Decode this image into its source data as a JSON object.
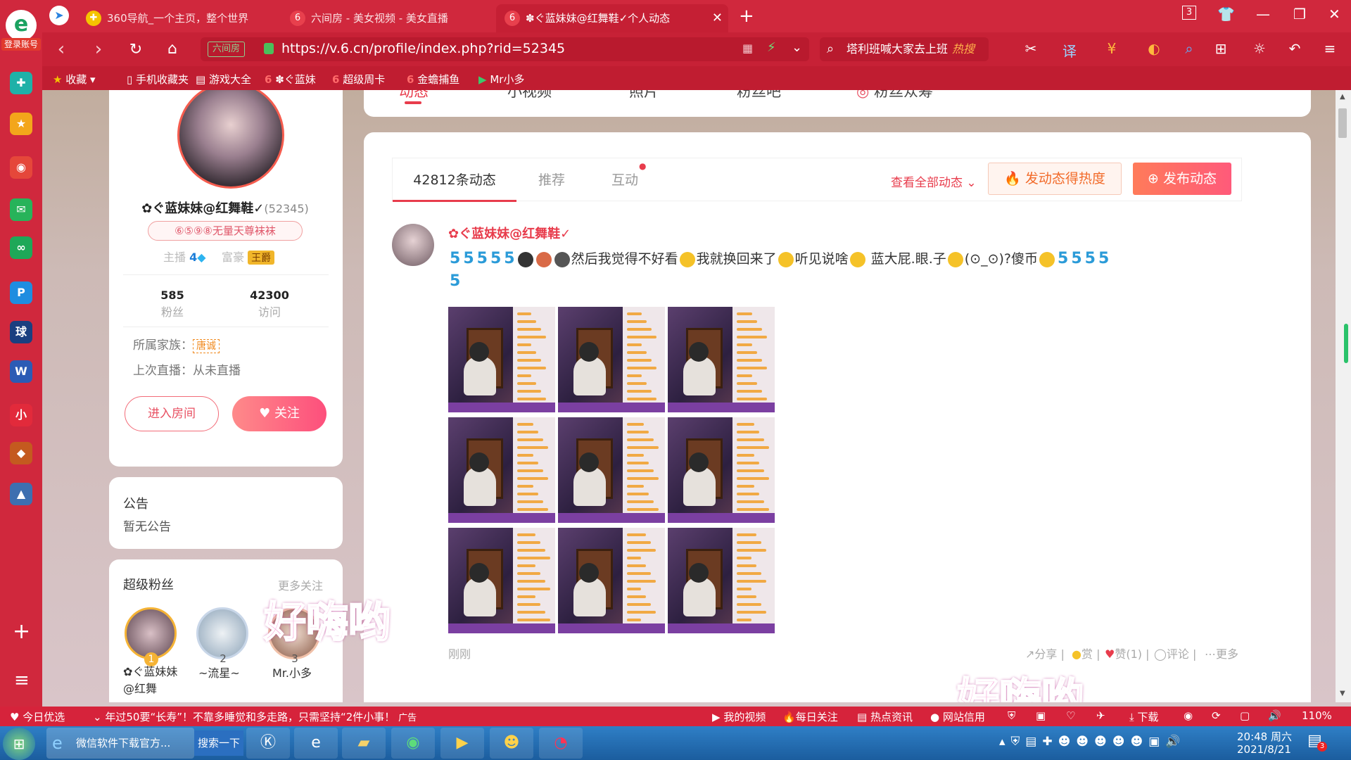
{
  "leftbar": {
    "login_label": "登录账号",
    "icons": [
      {
        "name": "plus-app-icon",
        "glyph": "✚",
        "color": "#1fb1a8"
      },
      {
        "name": "star-favorite-icon",
        "glyph": "★",
        "color": "#f3a61b"
      },
      {
        "name": "weibo-icon",
        "glyph": "◉",
        "color": "#e5473a"
      },
      {
        "name": "mail-icon",
        "glyph": "✉",
        "color": "#27b35a"
      },
      {
        "name": "link-app-icon",
        "glyph": "∞",
        "color": "#1ea858"
      },
      {
        "name": "p-app-icon",
        "glyph": "P",
        "color": "#1f8de0"
      },
      {
        "name": "sports-app-icon",
        "glyph": "球",
        "color": "#1a3f80"
      },
      {
        "name": "word-doc-icon",
        "glyph": "W",
        "color": "#2b5bb5"
      },
      {
        "name": "xiaohongshu-icon",
        "glyph": "小",
        "color": "#e22a3b"
      },
      {
        "name": "game-app-icon",
        "glyph": "◆",
        "color": "#c45a1f"
      },
      {
        "name": "game2-app-icon",
        "glyph": "▲",
        "color": "#3d6fb0"
      }
    ],
    "add_glyph": "+",
    "menu_glyph": "≡"
  },
  "tabs": [
    {
      "label": "360导航_一个主页，整个世界",
      "icon_glyph": "✚",
      "icon_color": "#f5c400"
    },
    {
      "label": "六间房 - 美女视频 - 美女直播",
      "icon_glyph": "6",
      "icon_color": "#e8404d"
    },
    {
      "label": "✽ぐ蓝妹妹@红舞鞋✓个人动态",
      "icon_glyph": "6",
      "icon_color": "#e8404d"
    }
  ],
  "tab_close": "✕",
  "new_tab": "+",
  "window_controls": {
    "tab_count": "3",
    "shirt": "👕",
    "min": "—",
    "restore": "❐",
    "close": "✕"
  },
  "address": {
    "badge": "六间房",
    "url": "https://v.6.cn/profile/index.php?rid=52345"
  },
  "search": {
    "text": "塔利班喊大家去上班",
    "hot": "热搜"
  },
  "bookmarks": [
    {
      "label": "收藏",
      "glyph": "★"
    },
    {
      "label": "手机收藏夹",
      "glyph": "▯"
    },
    {
      "label": "游戏大全",
      "glyph": "▤"
    },
    {
      "label": "✽ぐ蓝妹",
      "glyph": "6"
    },
    {
      "label": "超级周卡",
      "glyph": "6"
    },
    {
      "label": "金蟾捕鱼",
      "glyph": "6"
    },
    {
      "label": "Mr小多",
      "glyph": "▶"
    }
  ],
  "profile": {
    "name": "✿ぐ蓝妹妹@红舞鞋✓",
    "rid": "(52345)",
    "title_tag": "⑥⑤⑨⑧无量天尊袜袜",
    "anchor_label": "主播",
    "anchor_level": "4",
    "rich_label": "富豪",
    "rich_level": "王爵",
    "fans_count": "585",
    "fans_label": "粉丝",
    "visits_count": "42300",
    "visits_label": "访问",
    "family_label": "所属家族：",
    "family_value": "唐诚",
    "last_live_label": "上次直播：从未直播",
    "enter_room": "进入房间",
    "follow": "关注"
  },
  "notice": {
    "title": "公告",
    "content": "暂无公告"
  },
  "superfans": {
    "title": "超级粉丝",
    "more": "更多关注",
    "fans": [
      {
        "rank": "1",
        "name": "✿ぐ蓝妹妹@红舞"
      },
      {
        "rank": "2",
        "name": "~流星~"
      },
      {
        "rank": "3",
        "name": "Mr.小多"
      }
    ]
  },
  "topnav": [
    "动态",
    "小视频",
    "照片",
    "粉丝吧",
    "粉丝众筹"
  ],
  "feed": {
    "tabs": [
      "42812条动态",
      "推荐",
      "互动"
    ],
    "view_all": "查看全部动态",
    "heat_btn": "发动态得热度",
    "post_btn": "发布动态",
    "post": {
      "author": "✿ぐ蓝妹妹@红舞鞋✓",
      "text1": "然后我觉得不好看",
      "text2": "我就换回来了",
      "text3": "听见说啥",
      "text4": "蓝大屁.眼.子",
      "text5": "(⊙_⊙)?傻币",
      "time": "刚刚"
    },
    "actions": {
      "share": "分享",
      "reward": "赏",
      "like": "赞(1)",
      "comment": "评论",
      "more": "更多"
    }
  },
  "overlay": {
    "text1": "好嗨哟",
    "text2": "好嗨哟"
  },
  "statusbar": {
    "today": "今日优选",
    "news": "年过50要“长寿”！不靠多睡觉和多走路，只需坚持“2件小事！",
    "ad": "广告",
    "video": "我的视频",
    "daily": "每日关注",
    "hot": "热点资讯",
    "credit": "网站信用",
    "download": "下载",
    "zoom": "110%"
  },
  "taskbar": {
    "task_label": "微信软件下载官方...",
    "search_btn": "搜索一下",
    "time": "20:48 周六",
    "date": "2021/8/21"
  }
}
